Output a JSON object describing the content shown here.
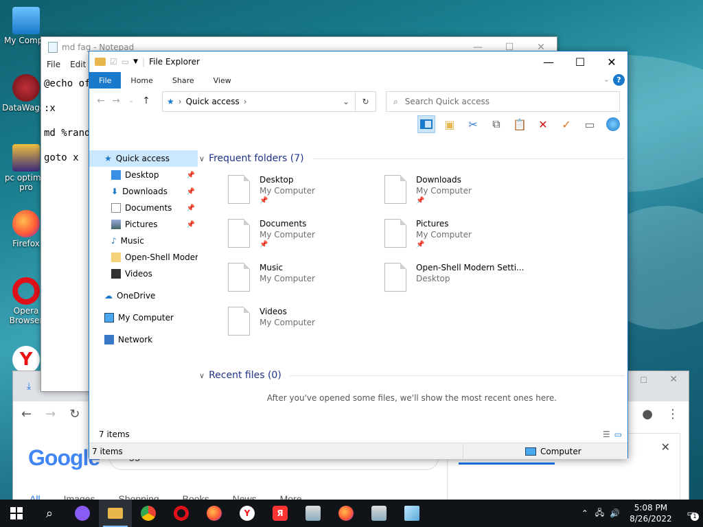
{
  "desktop": {
    "icons": [
      {
        "label": "My Compu"
      },
      {
        "label": "DataWagon"
      },
      {
        "label": "pc optimiz pro"
      },
      {
        "label": "Firefox"
      },
      {
        "label": "Opera Browser"
      }
    ]
  },
  "notepad": {
    "title": "md fag - Notepad",
    "menu": [
      "File",
      "Edit"
    ],
    "lines": [
      "@echo of",
      ":x",
      "md %rand",
      "goto x"
    ]
  },
  "chrome": {
    "google_logo": "Google",
    "search_value": "nigger",
    "result_tabs": [
      "All",
      "Images",
      "Shopping",
      "Books",
      "News",
      "More"
    ]
  },
  "explorer": {
    "title": "File Explorer",
    "ribbon_tabs": [
      "File",
      "Home",
      "Share",
      "View"
    ],
    "address": {
      "location": "Quick access"
    },
    "search": {
      "placeholder": "Search Quick access"
    },
    "nav": {
      "quick_access": "Quick access",
      "items": [
        {
          "label": "Desktop",
          "pinned": true
        },
        {
          "label": "Downloads",
          "pinned": true
        },
        {
          "label": "Documents",
          "pinned": true
        },
        {
          "label": "Pictures",
          "pinned": true
        },
        {
          "label": "Music",
          "pinned": false
        },
        {
          "label": "Open-Shell Modern",
          "pinned": false
        },
        {
          "label": "Videos",
          "pinned": false
        }
      ],
      "onedrive": "OneDrive",
      "my_computer": "My Computer",
      "network": "Network"
    },
    "frequent": {
      "heading": "Frequent folders (7)",
      "folders": [
        {
          "name": "Desktop",
          "location": "My Computer",
          "pinned": true
        },
        {
          "name": "Downloads",
          "location": "My Computer",
          "pinned": true
        },
        {
          "name": "Documents",
          "location": "My Computer",
          "pinned": true
        },
        {
          "name": "Pictures",
          "location": "My Computer",
          "pinned": true
        },
        {
          "name": "Music",
          "location": "My Computer",
          "pinned": false
        },
        {
          "name": "Open-Shell Modern Setti...",
          "location": "Desktop",
          "pinned": false
        },
        {
          "name": "Videos",
          "location": "My Computer",
          "pinned": false
        }
      ]
    },
    "recent": {
      "heading": "Recent files (0)",
      "empty_message": "After you've opened some files, we'll show the most recent ones here."
    },
    "status": {
      "items": "7 items"
    },
    "bottom_bar": {
      "items": "7 items",
      "location": "Computer"
    }
  },
  "taskbar": {
    "time": "5:08 PM",
    "date": "8/26/2022",
    "notification_count": "1"
  },
  "colors": {
    "accent": "#1979ca",
    "taskbar": "#101318"
  }
}
